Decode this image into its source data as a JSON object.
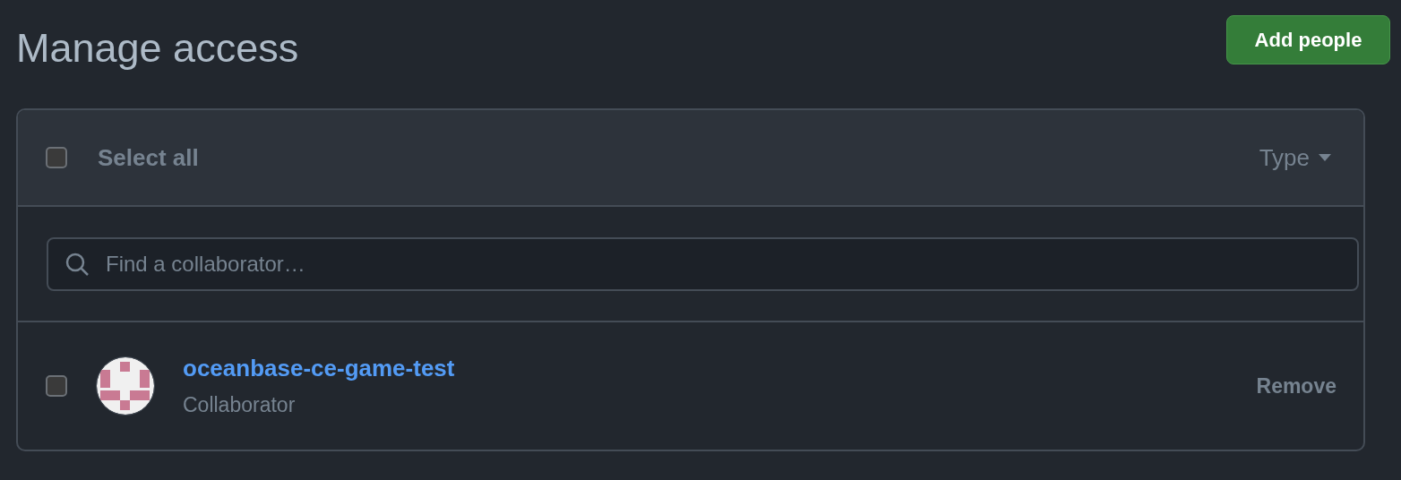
{
  "page": {
    "title": "Manage access"
  },
  "add_button": {
    "label": "Add people"
  },
  "header": {
    "select_all": {
      "label": "Select all",
      "checked": false
    },
    "type_filter": {
      "label": "Type"
    }
  },
  "search": {
    "placeholder": "Find a collaborator…"
  },
  "members": [
    {
      "name": "oceanbase-ce-game-test",
      "role": "Collaborator",
      "checked": false,
      "action": "Remove"
    }
  ]
}
